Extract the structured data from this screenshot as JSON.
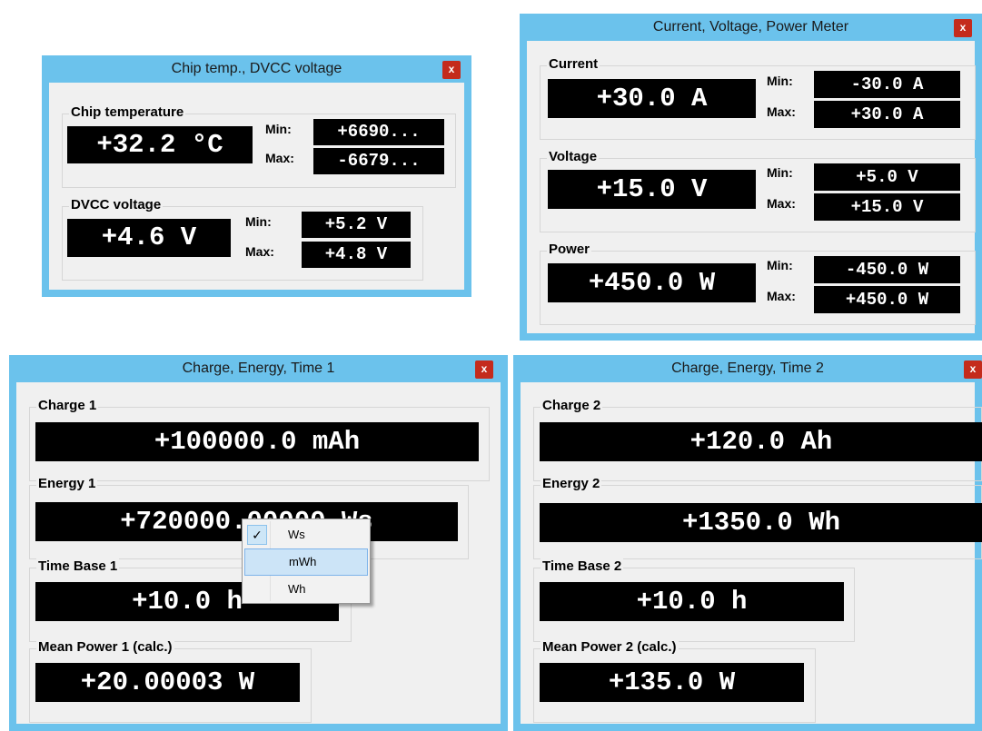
{
  "chip_window": {
    "title": "Chip temp., DVCC voltage",
    "close": "x",
    "chip_temperature": {
      "label": "Chip temperature",
      "value": "+32.2 °C",
      "min_label": "Min:",
      "min": "+6690...",
      "max_label": "Max:",
      "max": "-6679..."
    },
    "dvcc_voltage": {
      "label": "DVCC voltage",
      "value": "+4.6 V",
      "min_label": "Min:",
      "min": "+5.2 V",
      "max_label": "Max:",
      "max": "+4.8 V"
    }
  },
  "meter_window": {
    "title": "Current, Voltage, Power Meter",
    "close": "x",
    "current": {
      "label": "Current",
      "value": "+30.0 A",
      "min_label": "Min:",
      "min": "-30.0 A",
      "max_label": "Max:",
      "max": "+30.0 A"
    },
    "voltage": {
      "label": "Voltage",
      "value": "+15.0 V",
      "min_label": "Min:",
      "min": "+5.0 V",
      "max_label": "Max:",
      "max": "+15.0 V"
    },
    "power": {
      "label": "Power",
      "value": "+450.0 W",
      "min_label": "Min:",
      "min": "-450.0 W",
      "max_label": "Max:",
      "max": "+450.0 W"
    }
  },
  "cet1_window": {
    "title": "Charge, Energy, Time 1",
    "close": "x",
    "charge": {
      "label": "Charge 1",
      "value": "+100000.0 mAh"
    },
    "energy": {
      "label": "Energy 1",
      "value": "+720000.00000 Ws"
    },
    "time_base": {
      "label": "Time Base 1",
      "value": "+10.0 h"
    },
    "mean_power": {
      "label": "Mean Power 1 (calc.)",
      "value": "+20.00003 W"
    }
  },
  "cet2_window": {
    "title": "Charge, Energy, Time 2",
    "close": "x",
    "charge": {
      "label": "Charge 2",
      "value": "+120.0 Ah"
    },
    "energy": {
      "label": "Energy 2",
      "value": "+1350.0 Wh"
    },
    "time_base": {
      "label": "Time Base 2",
      "value": "+10.0 h"
    },
    "mean_power": {
      "label": "Mean Power 2 (calc.)",
      "value": "+135.0 W"
    }
  },
  "unit_menu": {
    "check_mark": "✓",
    "items": [
      {
        "label": "Ws",
        "checked": true
      },
      {
        "label": "mWh",
        "highlighted": true
      },
      {
        "label": "Wh"
      }
    ]
  },
  "colors": {
    "title_bar": "#6bc2ec",
    "close_button": "#c42b1c",
    "client": "#f0f0f0",
    "display_bg": "#000000",
    "display_fg": "#ffffff"
  }
}
